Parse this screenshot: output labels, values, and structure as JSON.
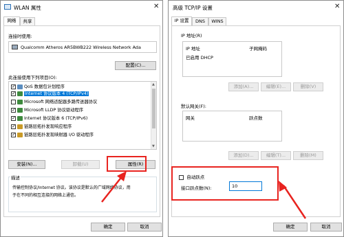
{
  "left": {
    "title": "WLAN 属性",
    "tabs": [
      "网络",
      "共享"
    ],
    "connect_using_label": "连接时使用:",
    "adapter_name": "Qualcomm Atheros AR5BWB222 Wireless Network Ada",
    "configure_button": "配置(C)...",
    "items_label": "此连接使用下列项目(O):",
    "items": [
      {
        "label": "QoS 数据包计划程序",
        "checked": true
      },
      {
        "label": "Internet 协议版本 4 (TCP/IPv4)",
        "checked": true,
        "selected": true
      },
      {
        "label": "Microsoft 网络适配器多路传送器协议",
        "checked": false
      },
      {
        "label": "Microsoft LLDP 协议驱动程序",
        "checked": true
      },
      {
        "label": "Internet 协议版本 6 (TCP/IPv6)",
        "checked": true
      },
      {
        "label": "链路层拓扑发现响应程序",
        "checked": true
      },
      {
        "label": "链路层拓扑发现映射器 I/O 驱动程序",
        "checked": true
      }
    ],
    "install_button": "安装(N)...",
    "uninstall_button": "卸载(U)",
    "properties_button": "属性(R)",
    "description_title": "描述",
    "description_line1": "传输控制协议/Internet 协议。该协议是默认的广域网络协议，用",
    "description_line2": "于在不同的相互连接的网络上通信。",
    "ok_button": "确定",
    "cancel_button": "取消"
  },
  "right": {
    "title": "高级 TCP/IP 设置",
    "tabs": [
      "IP 设置",
      "DNS",
      "WINS"
    ],
    "ip_group_title": "IP 地址(R)",
    "ip_columns": [
      "IP 地址",
      "子网掩码"
    ],
    "dhcp_text": "已启用 DHCP",
    "ip_add": "添加(A)...",
    "ip_edit": "编辑(E)...",
    "ip_delete": "删除(V)",
    "gw_group_title": "默认网关(F):",
    "gw_columns": [
      "网关",
      "跃点数"
    ],
    "gw_add": "添加(D)...",
    "gw_edit": "编辑(T)...",
    "gw_delete": "删除(M)",
    "auto_metric_label": "自动跃点",
    "auto_metric_checked": false,
    "interface_metric_label": "接口跃点数(N):",
    "interface_metric_value": "10",
    "ok_button": "确定",
    "cancel_button": "取消"
  },
  "colors": {
    "highlight": "#0078d7",
    "annotation": "#e8231f"
  }
}
